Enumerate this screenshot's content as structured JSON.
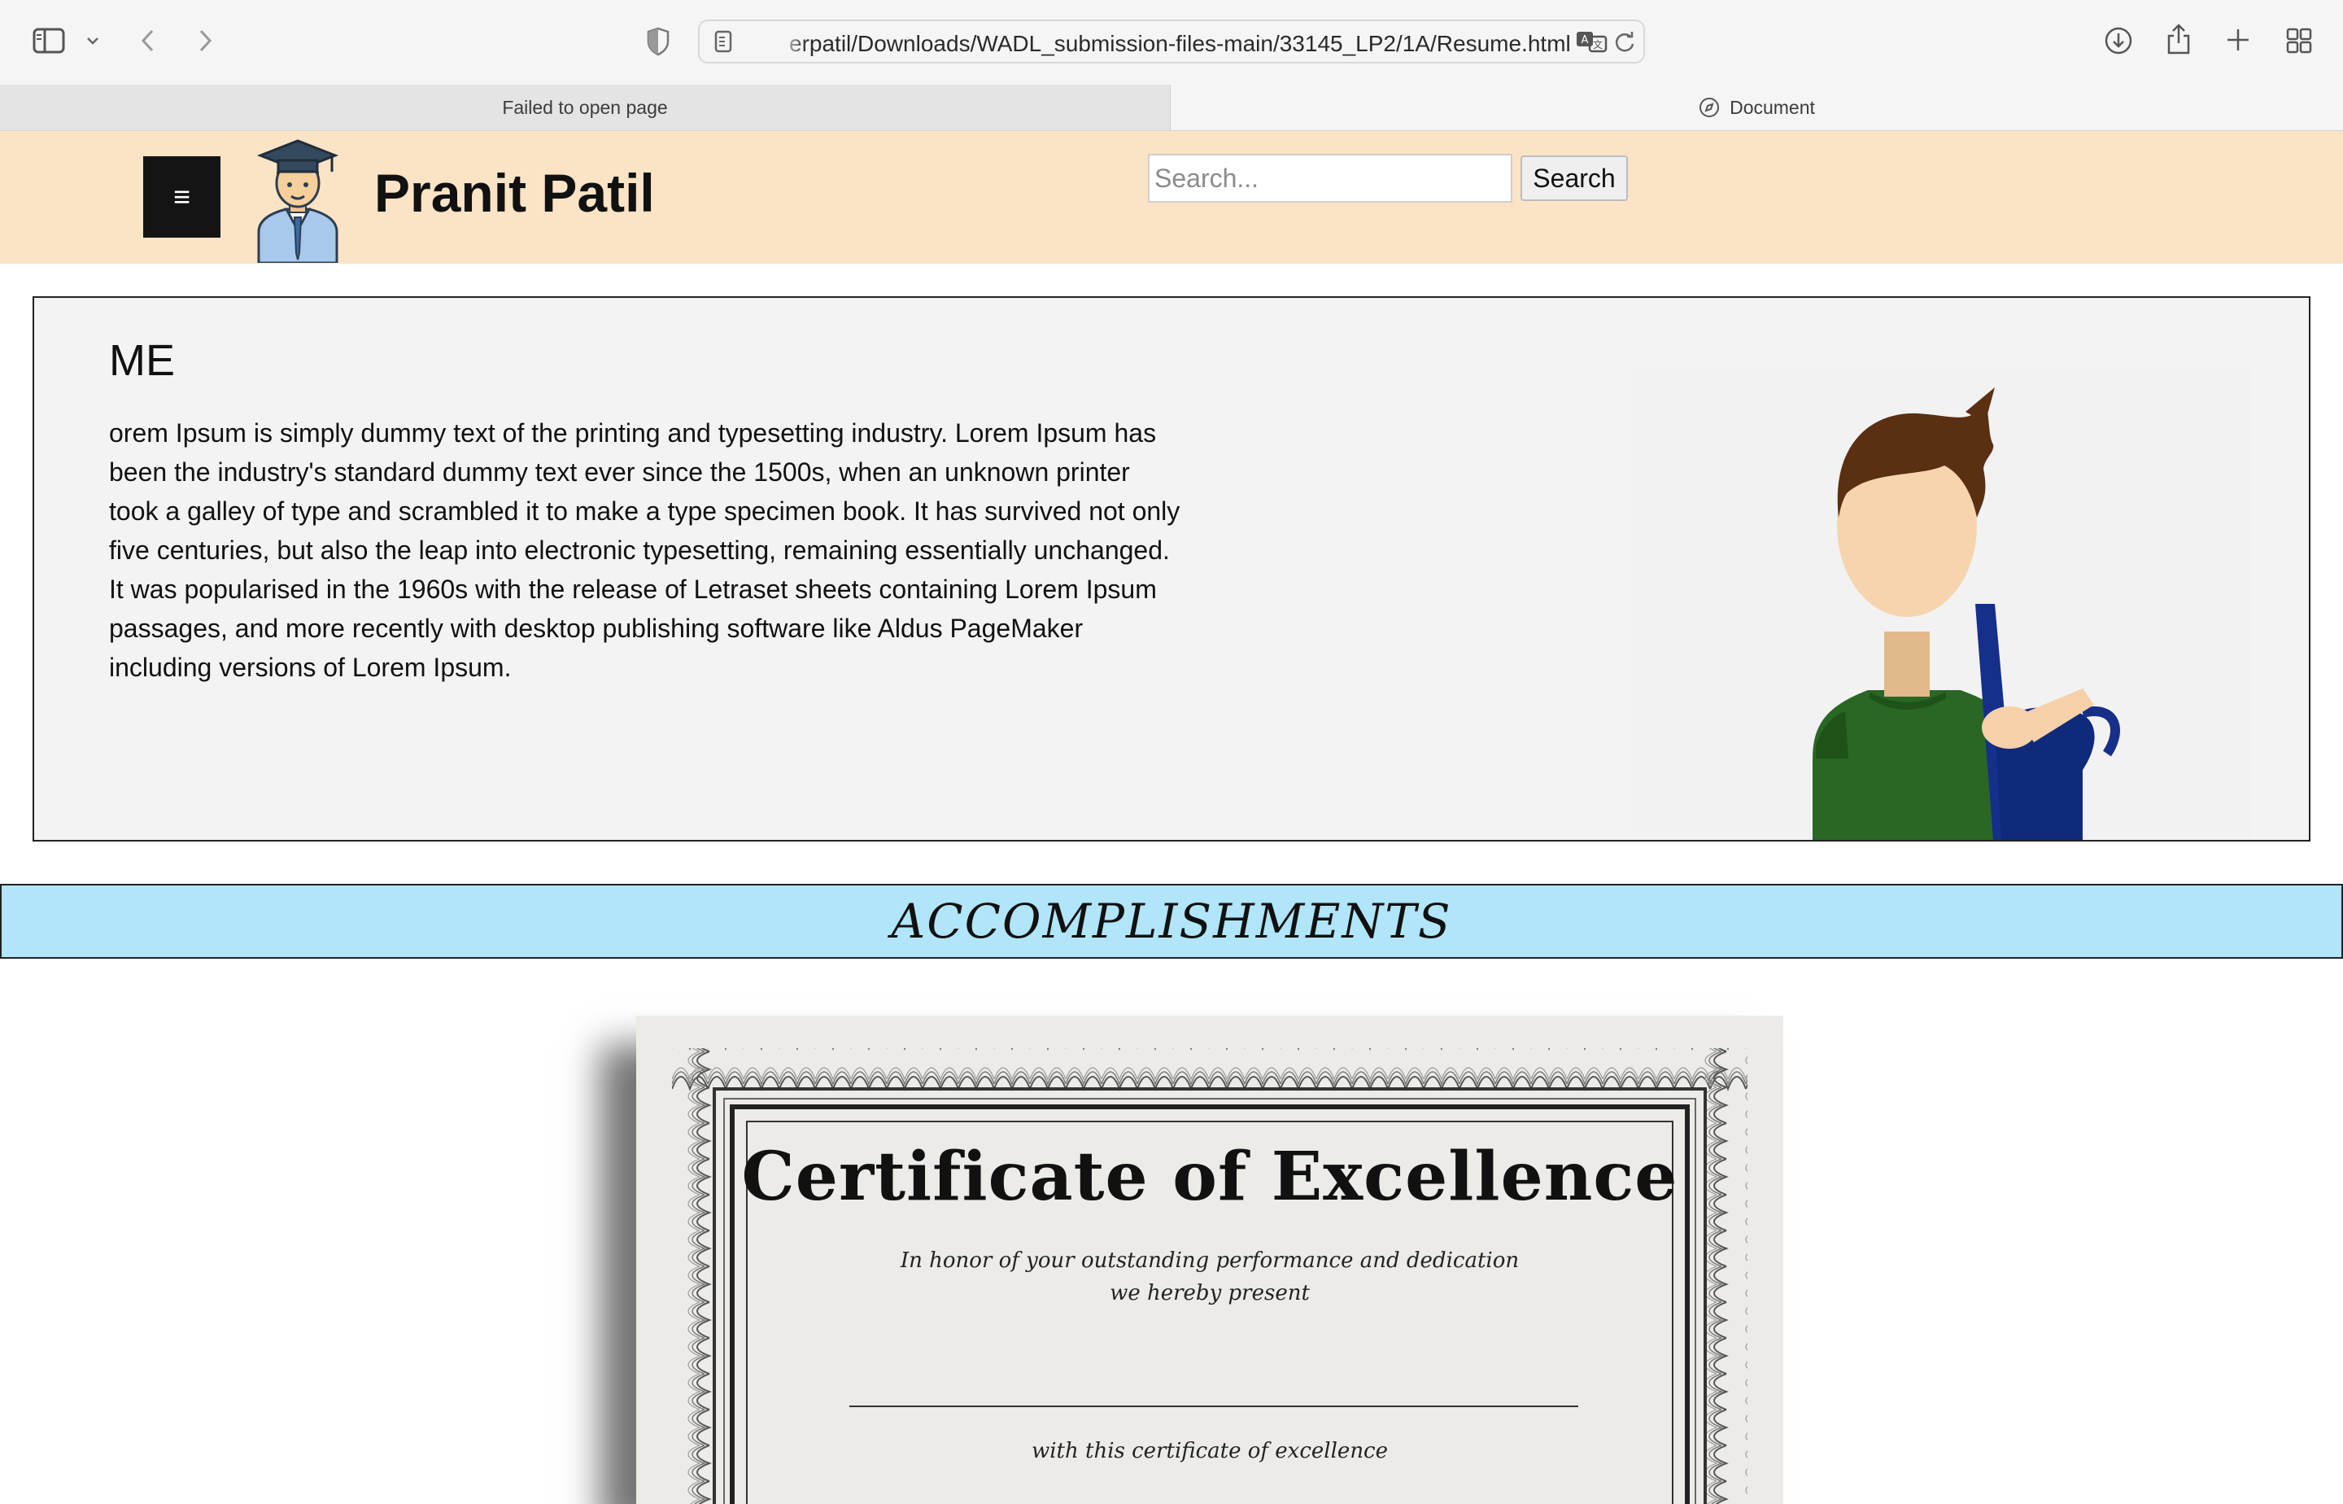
{
  "browser": {
    "url": "erpatil/Downloads/WADL_submission-files-main/33145_LP2/1A/Resume.html",
    "tabs": [
      {
        "label": "Failed to open page",
        "active": false
      },
      {
        "label": "Document",
        "active": true
      }
    ],
    "icons": [
      "sidebar-icon",
      "chevron-down-icon",
      "back-icon",
      "forward-icon",
      "shield-icon",
      "page-icon",
      "translate-icon",
      "reload-icon",
      "download-icon",
      "share-icon",
      "new-tab-icon",
      "tab-overview-icon",
      "compass-icon"
    ]
  },
  "header": {
    "menu_symbol": "≡",
    "name": "Pranit Patil",
    "search_placeholder": "Search...",
    "search_button": "Search",
    "background": "#fbe3c6"
  },
  "me": {
    "title": "ME",
    "text": "orem Ipsum is simply dummy text of the printing and typesetting industry. Lorem Ipsum has been the industry's standard dummy text ever since the 1500s, when an unknown printer took a galley of type and scrambled it to make a type specimen book. It has survived not only five centuries, but also the leap into electronic typesetting, remaining essentially unchanged. It was popularised in the 1960s with the release of Letraset sheets containing Lorem Ipsum passages, and more recently with desktop publishing software like Aldus PageMaker including versions of Lorem Ipsum."
  },
  "accomplishments": {
    "title": "ACCOMPLISHMENTS",
    "background": "#b0e5fa"
  },
  "certificate": {
    "title": "Certificate of Excellence",
    "line1": "In honor of your outstanding performance and dedication",
    "line2": "we hereby present",
    "line3": "with this certificate of excellence"
  }
}
